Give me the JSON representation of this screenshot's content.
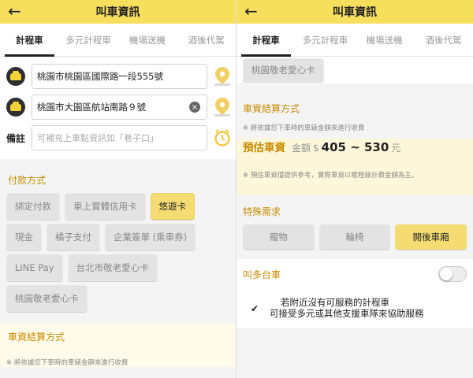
{
  "colors": {
    "accent": "#f7df5e",
    "section_title": "#c88c00",
    "selected_pill": "#f4dc72",
    "fare_bg": "#fdf7d9"
  },
  "left": {
    "header": {
      "back_icon": "arrow-left-icon",
      "title": "叫車資訊"
    },
    "tabs": [
      {
        "label": "計程車",
        "active": true
      },
      {
        "label": "多元計程車",
        "active": false
      },
      {
        "label": "機場送機",
        "active": false
      },
      {
        "label": "酒後代駕",
        "active": false
      }
    ],
    "pickup": {
      "value": "桃園市桃園區國際路一段555號"
    },
    "dropoff": {
      "value": "桃園市大園區航站南路９號"
    },
    "note": {
      "label": "備註",
      "placeholder": "可補充上車點資訊如「巷子口」"
    },
    "payment": {
      "title": "付款方式",
      "options": [
        {
          "label": "綁定付款",
          "selected": false
        },
        {
          "label": "車上實體信用卡",
          "selected": false
        },
        {
          "label": "悠遊卡",
          "selected": true
        },
        {
          "label": "現金",
          "selected": false
        },
        {
          "label": "橘子支付",
          "selected": false
        },
        {
          "label": "企業簽單 (乘車券)",
          "selected": false
        },
        {
          "label": "LINE Pay",
          "selected": false
        },
        {
          "label": "台北市敬老愛心卡",
          "selected": false
        },
        {
          "label": "桃園敬老愛心卡",
          "selected": false
        }
      ]
    },
    "fare": {
      "title": "車資結算方式",
      "note": "※ 將依據您下車時的車錶金額來進行收費"
    }
  },
  "right": {
    "header": {
      "back_icon": "arrow-left-icon",
      "title": "叫車資訊"
    },
    "tabs": [
      {
        "label": "計程車",
        "active": true
      },
      {
        "label": "多元計程車",
        "active": false
      },
      {
        "label": "機場送機",
        "active": false
      },
      {
        "label": "酒後代駕",
        "active": false
      }
    ],
    "top_option": {
      "label": "桃園敬老愛心卡"
    },
    "fare": {
      "title": "車資結算方式",
      "note": "※ 將依據您下車時的車錶金額來進行收費",
      "estimate_label": "預估車資",
      "amount_label": "金額",
      "currency": "$",
      "range": "405 ~ 530",
      "unit": "元",
      "disclaimer": "※ 預估車資僅提供參考，實際車資以喔程錶計費金額為主。"
    },
    "special": {
      "title": "特殊需求",
      "options": [
        {
          "label": "寵物",
          "selected": false
        },
        {
          "label": "輪椅",
          "selected": false
        },
        {
          "label": "開後車廂",
          "selected": true
        }
      ]
    },
    "multi_car": {
      "label": "叫多台車",
      "on": false
    },
    "fallback": {
      "checked": true,
      "line1": "若附近沒有可服務的計程車",
      "line2": "可接受多元或其他支援車隊來協助服務"
    }
  }
}
